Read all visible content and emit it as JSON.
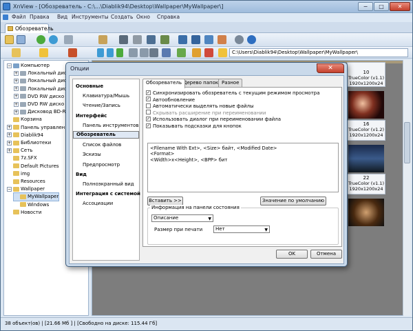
{
  "window": {
    "title": "XnView - [Обозреватель - C:\\...\\Diablik94\\Desktop\\Wallpaper\\MyWallpaper\\]",
    "min_glyph": "−",
    "max_glyph": "□",
    "close_glyph": "✕"
  },
  "menu": [
    "Файл",
    "Правка",
    "Вид",
    "Инструменты",
    "Создать",
    "Окно",
    "Справка"
  ],
  "main_tab": "Обозреватель",
  "toolbar2": {
    "path": "C:\\Users\\Diablik94\\Desktop\\Wallpaper\\MyWallpaper\\"
  },
  "tree": [
    {
      "label": "Компьютер",
      "level": 0,
      "exp": "−"
    },
    {
      "label": "Локальный диск",
      "level": 1,
      "exp": "+"
    },
    {
      "label": "Локальный диск",
      "level": 1,
      "exp": "+"
    },
    {
      "label": "Локальный диск",
      "level": 1,
      "exp": "+"
    },
    {
      "label": "DVD RW диско",
      "level": 1,
      "exp": "+"
    },
    {
      "label": "DVD RW диско",
      "level": 1,
      "exp": "+"
    },
    {
      "label": "Дисковод BD-R",
      "level": 1,
      "exp": "+"
    },
    {
      "label": "Корзина",
      "level": 0,
      "exp": ""
    },
    {
      "label": "Панель управлен",
      "level": 0,
      "exp": "+"
    },
    {
      "label": "Diablik94",
      "level": 0,
      "exp": "+"
    },
    {
      "label": "Библиотеки",
      "level": 0,
      "exp": "+"
    },
    {
      "label": "Сеть",
      "level": 0,
      "exp": "+"
    },
    {
      "label": "7z.SFX",
      "level": 0,
      "exp": ""
    },
    {
      "label": "Default Pictures",
      "level": 0,
      "exp": ""
    },
    {
      "label": "img",
      "level": 0,
      "exp": ""
    },
    {
      "label": "Resources",
      "level": 0,
      "exp": ""
    },
    {
      "label": "Wallpaper",
      "level": 0,
      "exp": "−"
    },
    {
      "label": "MyWallpaper",
      "level": 1,
      "exp": ""
    },
    {
      "label": "Windows",
      "level": 1,
      "exp": ""
    },
    {
      "label": "Новости",
      "level": 0,
      "exp": ""
    }
  ],
  "thumbs": [
    {
      "num": "10",
      "info1": "TrueColor (v1.1)",
      "info2": "1920x1200x24"
    },
    {
      "num": "16",
      "info1": "TrueColor (v1.2)",
      "info2": "1920x1200x24"
    },
    {
      "num": "22",
      "info1": "TrueColor (v1.1)",
      "info2": "1920x1200x24"
    }
  ],
  "status": "38 объект(ов) | [21.66 Мб ] | [Свободно на диске: 115.44 Гб]",
  "dialog": {
    "title": "Опции",
    "nav": [
      {
        "label": "Основные",
        "kind": "h"
      },
      {
        "label": "Клавиатура/Мышь",
        "kind": "i"
      },
      {
        "label": "Чтение/Запись",
        "kind": "i"
      },
      {
        "label": "Интерфейс",
        "kind": "h"
      },
      {
        "label": "Панель инструментов",
        "kind": "i"
      },
      {
        "label": "Обозреватель",
        "kind": "h",
        "selected": true
      },
      {
        "label": "Список файлов",
        "kind": "i"
      },
      {
        "label": "Эскизы",
        "kind": "i"
      },
      {
        "label": "Предпросмотр",
        "kind": "i"
      },
      {
        "label": "Вид",
        "kind": "h"
      },
      {
        "label": "Полноэкранный вид",
        "kind": "i"
      },
      {
        "label": "Интеграция с системой",
        "kind": "h"
      },
      {
        "label": "Ассоциации",
        "kind": "i"
      }
    ],
    "tabs": [
      "Обозреватель",
      "Дерево папок",
      "Разное"
    ],
    "checks": [
      {
        "label": "Синхронизировать обозреватель с текущим режимом просмотра",
        "checked": true,
        "disabled": false
      },
      {
        "label": "Автообновление",
        "checked": true,
        "disabled": false
      },
      {
        "label": "Автоматически выделять новые файлы",
        "checked": false,
        "disabled": false
      },
      {
        "label": "Скрывать расширение при переименовании",
        "checked": false,
        "disabled": true
      },
      {
        "label": "Использовать диалог при переименовании файла",
        "checked": true,
        "disabled": false
      },
      {
        "label": "Показывать подсказки для кнопок",
        "checked": true,
        "disabled": false
      }
    ],
    "tooltip_template": "<Filename With Ext>, <Size> байт, <Modified Date>\n<Format>\n<Width>x<Height>, <BPP> бит",
    "insert_button": "Вставить >>",
    "default_button": "Значение по умолчанию",
    "group_label": "Информация на панели состояния",
    "info_select": "Описание",
    "print_size_label": "Размер при печати",
    "print_size_select": "Нет",
    "ok": "OK",
    "cancel": "Отмена"
  },
  "colors": {
    "accent": "#3a7fd0",
    "folder": "#e7c25a"
  }
}
